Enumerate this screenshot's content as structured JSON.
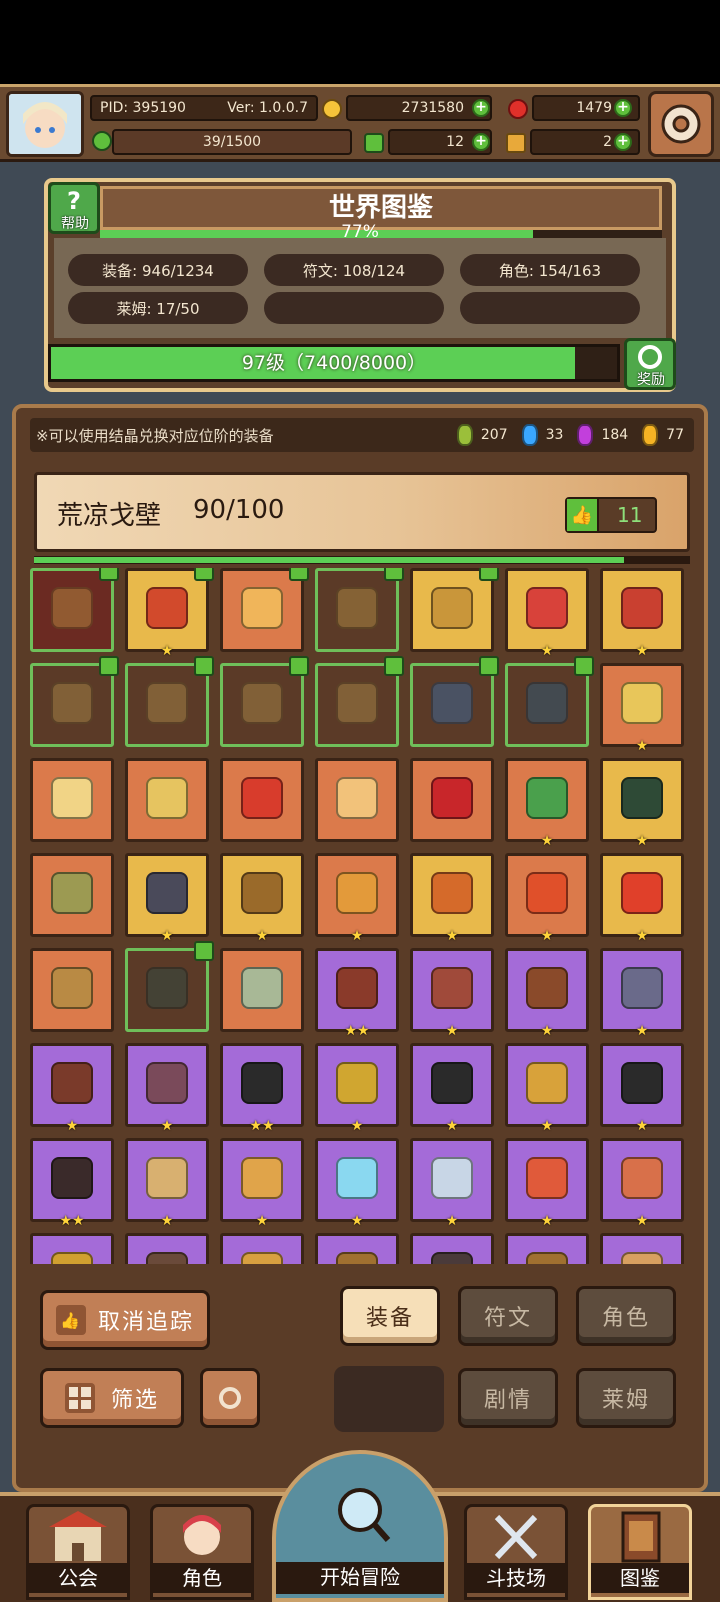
{
  "header": {
    "pid": "PID: 395190",
    "version": "Ver: 1.0.0.7",
    "gold": "2731580",
    "ruby": "1479",
    "stamina": "39/1500",
    "clover": "12",
    "hammer": "2"
  },
  "codex": {
    "title": "世界图鉴",
    "percent": "77%",
    "help_label": "帮助",
    "stats": [
      "装备: 946/1234",
      "符文: 108/124",
      "角色: 154/163",
      "莱姆: 17/50"
    ],
    "level_text": "97级（7400/8000）",
    "level_fraction": 0.925,
    "reward_label": "奖励"
  },
  "panel": {
    "info": "※可以使用结晶兑换对应位阶的装备",
    "crystals": [
      {
        "color": "#9bbf3a",
        "value": "207"
      },
      {
        "color": "#3aa7ff",
        "value": "33"
      },
      {
        "color": "#c23fdc",
        "value": "184"
      },
      {
        "color": "#f5b324",
        "value": "77"
      }
    ],
    "region_name": "荒凉戈壁",
    "region_progress": "90/100",
    "region_fraction": 0.9,
    "likes": "11"
  },
  "grid_items": [
    {
      "bg": "#6b2a22",
      "art": "#b88a40",
      "stars": "",
      "like": true,
      "dim": true
    },
    {
      "bg": "#e8b94b",
      "art": "#d24a2c",
      "stars": "★",
      "like": true
    },
    {
      "bg": "#db7a4b",
      "art": "#f0b55a",
      "stars": "",
      "like": true
    },
    {
      "bg": "#5b3a27",
      "art": "#b08a44",
      "stars": "",
      "like": true,
      "dim": true
    },
    {
      "bg": "#e8b94b",
      "art": "#c9963a",
      "stars": "",
      "like": true
    },
    {
      "bg": "#e8b94b",
      "art": "#d8423a",
      "stars": "★",
      "like": false
    },
    {
      "bg": "#e8b94b",
      "art": "#c94030",
      "stars": "★",
      "like": false
    },
    {
      "bg": "#5b3a27",
      "art": "#a88648",
      "stars": "",
      "like": true,
      "dim": true
    },
    {
      "bg": "#5b3a27",
      "art": "#a88648",
      "stars": "",
      "like": true,
      "dim": true
    },
    {
      "bg": "#5b3a27",
      "art": "#a88648",
      "stars": "",
      "like": true,
      "dim": true
    },
    {
      "bg": "#5b3a27",
      "art": "#a88648",
      "stars": "",
      "like": true,
      "dim": true
    },
    {
      "bg": "#5b3a27",
      "art": "#3a6aa0",
      "stars": "",
      "like": true,
      "dim": true
    },
    {
      "bg": "#5b3a27",
      "art": "#2c5a7a",
      "stars": "",
      "like": true,
      "dim": true
    },
    {
      "bg": "#db7a4b",
      "art": "#e8c65a",
      "stars": "★",
      "like": false
    },
    {
      "bg": "#db7a4b",
      "art": "#f1d486",
      "stars": "",
      "like": false
    },
    {
      "bg": "#db7a4b",
      "art": "#e6c460",
      "stars": "",
      "like": false
    },
    {
      "bg": "#db7a4b",
      "art": "#d83c2c",
      "stars": "",
      "like": false
    },
    {
      "bg": "#db7a4b",
      "art": "#f2c27a",
      "stars": "",
      "like": false
    },
    {
      "bg": "#db7a4b",
      "art": "#c8262a",
      "stars": "",
      "like": false
    },
    {
      "bg": "#db7a4b",
      "art": "#4aa04c",
      "stars": "★",
      "like": false
    },
    {
      "bg": "#e8b94b",
      "art": "#2e4a36",
      "stars": "★",
      "like": false
    },
    {
      "bg": "#db7a4b",
      "art": "#9c9a52",
      "stars": "",
      "like": false
    },
    {
      "bg": "#e8b94b",
      "art": "#4a4a5a",
      "stars": "★",
      "like": false
    },
    {
      "bg": "#e8b94b",
      "art": "#9a6a2a",
      "stars": "★",
      "like": false
    },
    {
      "bg": "#db7a4b",
      "art": "#e39a3a",
      "stars": "★",
      "like": false
    },
    {
      "bg": "#e8b94b",
      "art": "#d56a2a",
      "stars": "★",
      "like": false
    },
    {
      "bg": "#db7a4b",
      "art": "#e0502a",
      "stars": "★",
      "like": false
    },
    {
      "bg": "#e8b94b",
      "art": "#e0402a",
      "stars": "★",
      "like": false
    },
    {
      "bg": "#db7a4b",
      "art": "#b98a44",
      "stars": "",
      "like": false
    },
    {
      "bg": "#5b3a27",
      "art": "#2f4a44",
      "stars": "",
      "like": true,
      "dim": true
    },
    {
      "bg": "#db7a4b",
      "art": "#a8b896",
      "stars": "",
      "like": false
    },
    {
      "bg": "#a46bd8",
      "art": "#8a3a2a",
      "stars": "★★",
      "like": false
    },
    {
      "bg": "#a46bd8",
      "art": "#a04a3a",
      "stars": "★",
      "like": false
    },
    {
      "bg": "#a46bd8",
      "art": "#8a4a2a",
      "stars": "★",
      "like": false
    },
    {
      "bg": "#a46bd8",
      "art": "#6a6a8a",
      "stars": "★",
      "like": false
    },
    {
      "bg": "#a46bd8",
      "art": "#7a3a2a",
      "stars": "★",
      "like": false
    },
    {
      "bg": "#a46bd8",
      "art": "#7a4a5a",
      "stars": "★",
      "like": false
    },
    {
      "bg": "#a46bd8",
      "art": "#2a2a2a",
      "stars": "★★",
      "like": false
    },
    {
      "bg": "#a46bd8",
      "art": "#d0a630",
      "stars": "★",
      "like": false
    },
    {
      "bg": "#a46bd8",
      "art": "#2a2a2a",
      "stars": "★",
      "like": false
    },
    {
      "bg": "#a46bd8",
      "art": "#d8a23a",
      "stars": "★",
      "like": false
    },
    {
      "bg": "#a46bd8",
      "art": "#2a2a2a",
      "stars": "★",
      "like": false
    },
    {
      "bg": "#a46bd8",
      "art": "#3a2a2a",
      "stars": "★★",
      "like": false
    },
    {
      "bg": "#a46bd8",
      "art": "#d8b070",
      "stars": "★",
      "like": false
    },
    {
      "bg": "#a46bd8",
      "art": "#e0a44a",
      "stars": "★",
      "like": false
    },
    {
      "bg": "#a46bd8",
      "art": "#8ad8f0",
      "stars": "★",
      "like": false
    },
    {
      "bg": "#a46bd8",
      "art": "#c8d6e6",
      "stars": "★",
      "like": false
    },
    {
      "bg": "#a46bd8",
      "art": "#e05a3a",
      "stars": "★",
      "like": false
    },
    {
      "bg": "#a46bd8",
      "art": "#d8704a",
      "stars": "★",
      "like": false
    },
    {
      "bg": "#a46bd8",
      "art": "#d0a030",
      "stars": "",
      "like": false
    },
    {
      "bg": "#a46bd8",
      "art": "#6a4a3a",
      "stars": "",
      "like": false
    },
    {
      "bg": "#a46bd8",
      "art": "#d8a040",
      "stars": "",
      "like": false
    },
    {
      "bg": "#a46bd8",
      "art": "#a07030",
      "stars": "",
      "like": false
    },
    {
      "bg": "#a46bd8",
      "art": "#4a3a3a",
      "stars": "",
      "like": false
    },
    {
      "bg": "#a46bd8",
      "art": "#a07030",
      "stars": "",
      "like": false
    },
    {
      "bg": "#a46bd8",
      "art": "#d8a060",
      "stars": "",
      "like": false
    }
  ],
  "actions": {
    "untrack": "取消追踪",
    "filter": "筛选",
    "tab_equipment": "装备",
    "tab_rune": "符文",
    "tab_character": "角色",
    "tab_story": "剧情",
    "tab_slime": "莱姆"
  },
  "nav": {
    "guild": "公会",
    "character": "角色",
    "adventure": "开始冒险",
    "arena": "斗技场",
    "codex": "图鉴"
  },
  "colors": {
    "gold_coin": "#f6c43a",
    "ruby": "#e0302a",
    "clover": "#5fbf3c",
    "progress_green": "#5ccf55"
  }
}
